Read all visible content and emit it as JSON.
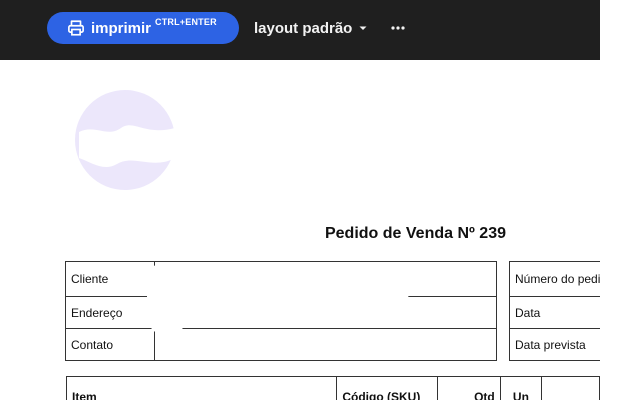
{
  "toolbar": {
    "print_label": "imprimir",
    "print_shortcut": "CTRL+ENTER",
    "layout_label": "layout padrão",
    "more_label": "⋯"
  },
  "document": {
    "title": "Pedido de Venda Nº 239",
    "client_fields": [
      {
        "label": "Cliente",
        "value": ""
      },
      {
        "label": "Endereço",
        "value": ""
      },
      {
        "label": "Contato",
        "value": ""
      }
    ],
    "meta_fields": [
      {
        "label": "Número do pedido"
      },
      {
        "label": "Data"
      },
      {
        "label": "Data prevista"
      }
    ],
    "items_headers": {
      "item": "Item",
      "sku": "Código (SKU)",
      "qtd": "Qtd",
      "un": "Un"
    }
  },
  "colors": {
    "topbar": "#1f1f1f",
    "accent": "#2d63e4",
    "logo_tint": "#ece7fb"
  },
  "icons": {
    "print": "printer-icon",
    "dropdown": "chevron-down-icon",
    "more": "more-horizontal-icon",
    "logo": "company-logo"
  }
}
